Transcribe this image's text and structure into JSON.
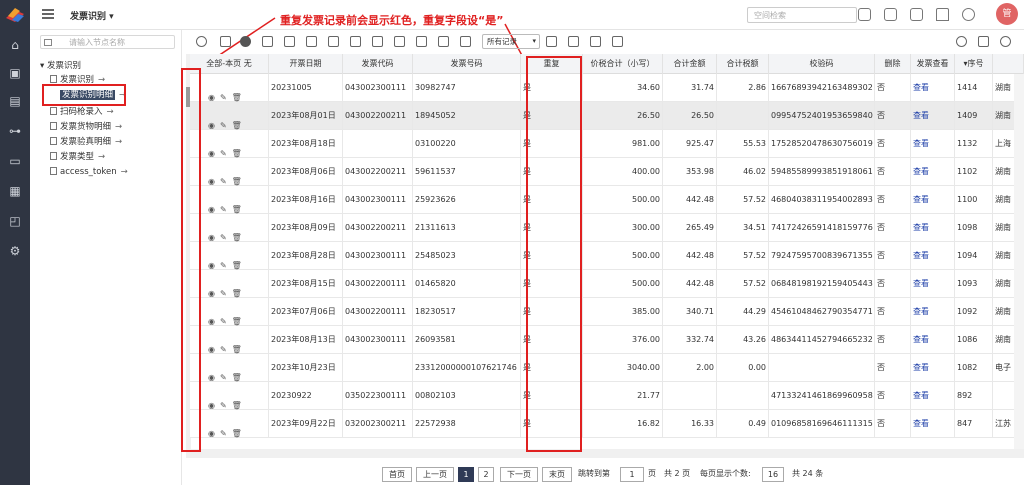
{
  "app": {
    "title": "发票识别"
  },
  "search": {
    "placeholder": "空间检索"
  },
  "avatar": {
    "initial": "管"
  },
  "annotation": {
    "text": "重复发票记录前会显示红色，重复字段设“是”"
  },
  "tree": {
    "search_placeholder": "请输入节点名称",
    "root": "发票识别",
    "items": [
      {
        "label": "发票识别"
      },
      {
        "label": "发票识别明细"
      },
      {
        "label": "扫码枪录入"
      },
      {
        "label": "发票货物明细"
      },
      {
        "label": "发票验真明细"
      },
      {
        "label": "发票类型"
      },
      {
        "label": "access_token"
      }
    ]
  },
  "toolbar": {
    "filter_select": "所有记录"
  },
  "table": {
    "headers": [
      "全部-本页 无",
      "开票日期",
      "发票代码",
      "发票号码",
      "重复",
      "价税合计（小写）",
      "合计金额",
      "合计税额",
      "校验码",
      "删除",
      "发票查看",
      "▾序号",
      ""
    ],
    "rows": [
      {
        "date": "20231005",
        "code": "043002300111",
        "number": "30982747",
        "dup": "是",
        "total": "34.60",
        "amount": "31.74",
        "tax": "2.86",
        "check": "16676893942163489302",
        "del": "否",
        "view": "查看",
        "seq": "1414",
        "extra": "湖南"
      },
      {
        "date": "2023年08月01日",
        "code": "043002200211",
        "number": "18945052",
        "dup": "是",
        "total": "26.50",
        "amount": "26.50",
        "tax": "",
        "check": "09954752401953659840",
        "del": "否",
        "view": "查看",
        "seq": "1409",
        "extra": "湖南"
      },
      {
        "date": "2023年08月18日",
        "code": "",
        "number": "03100220",
        "dup": "是",
        "total": "981.00",
        "amount": "925.47",
        "tax": "55.53",
        "check": "17528520478630756019",
        "del": "否",
        "view": "查看",
        "seq": "1132",
        "extra": "上海"
      },
      {
        "date": "2023年08月06日",
        "code": "043002200211",
        "number": "59611537",
        "dup": "是",
        "total": "400.00",
        "amount": "353.98",
        "tax": "46.02",
        "check": "59485589993851918061",
        "del": "否",
        "view": "查看",
        "seq": "1102",
        "extra": "湖南"
      },
      {
        "date": "2023年08月16日",
        "code": "043002300111",
        "number": "25923626",
        "dup": "是",
        "total": "500.00",
        "amount": "442.48",
        "tax": "57.52",
        "check": "46804038311954002893",
        "del": "否",
        "view": "查看",
        "seq": "1100",
        "extra": "湖南"
      },
      {
        "date": "2023年08月09日",
        "code": "043002200211",
        "number": "21311613",
        "dup": "是",
        "total": "300.00",
        "amount": "265.49",
        "tax": "34.51",
        "check": "74172426591418159776",
        "del": "否",
        "view": "查看",
        "seq": "1098",
        "extra": "湖南"
      },
      {
        "date": "2023年08月28日",
        "code": "043002300111",
        "number": "25485023",
        "dup": "是",
        "total": "500.00",
        "amount": "442.48",
        "tax": "57.52",
        "check": "79247595700839671355",
        "del": "否",
        "view": "查看",
        "seq": "1094",
        "extra": "湖南"
      },
      {
        "date": "2023年08月15日",
        "code": "043002200111",
        "number": "01465820",
        "dup": "是",
        "total": "500.00",
        "amount": "442.48",
        "tax": "57.52",
        "check": "06848198192159405443",
        "del": "否",
        "view": "查看",
        "seq": "1093",
        "extra": "湖南"
      },
      {
        "date": "2023年07月06日",
        "code": "043002200111",
        "number": "18230517",
        "dup": "是",
        "total": "385.00",
        "amount": "340.71",
        "tax": "44.29",
        "check": "45461048462790354771",
        "del": "否",
        "view": "查看",
        "seq": "1092",
        "extra": "湖南"
      },
      {
        "date": "2023年08月13日",
        "code": "043002300111",
        "number": "26093581",
        "dup": "是",
        "total": "376.00",
        "amount": "332.74",
        "tax": "43.26",
        "check": "48634411452794665232",
        "del": "否",
        "view": "查看",
        "seq": "1086",
        "extra": "湖南"
      },
      {
        "date": "2023年10月23日",
        "code": "",
        "number": "23312000000107621746",
        "dup": "是",
        "total": "3040.00",
        "amount": "2.00",
        "tax": "0.00",
        "check": "",
        "del": "否",
        "view": "查看",
        "seq": "1082",
        "extra": "电子"
      },
      {
        "date": "20230922",
        "code": "035022300111",
        "number": "00802103",
        "dup": "是",
        "total": "21.77",
        "amount": "",
        "tax": "",
        "check": "47133241461869960958",
        "del": "否",
        "view": "查看",
        "seq": "892",
        "extra": ""
      },
      {
        "date": "2023年09月22日",
        "code": "032002300211",
        "number": "22572938",
        "dup": "是",
        "total": "16.82",
        "amount": "16.33",
        "tax": "0.49",
        "check": "01096858169646111315",
        "del": "否",
        "view": "查看",
        "seq": "847",
        "extra": "江苏"
      }
    ]
  },
  "pager": {
    "first": "首页",
    "prev": "上一页",
    "page1": "1",
    "page2": "2",
    "next": "下一页",
    "last": "末页",
    "jump_label": "跳转到第",
    "jump_value": "1",
    "page_unit": "页",
    "total_pages": "共 2 页",
    "per_page_label": "每页显示个数:",
    "per_page": "16",
    "total_items": "共 24 条"
  }
}
